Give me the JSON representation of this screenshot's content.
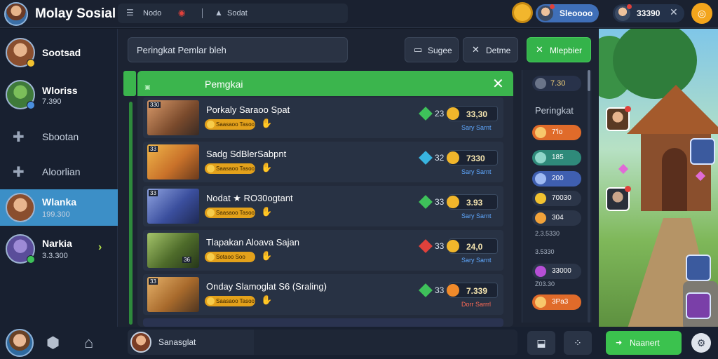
{
  "topbar": {
    "app_title": "Molay Sosial",
    "tools": [
      {
        "icon": "list-icon",
        "label": "Nodo"
      },
      {
        "icon": "eye-icon",
        "label": ""
      },
      {
        "icon": "warning-icon",
        "label": "Sodat"
      }
    ],
    "currency_blue": "Sleoooo",
    "currency_dark": "33390"
  },
  "sidebar": {
    "items": [
      {
        "name": "Sootsad",
        "sub": "",
        "kind": "avatar",
        "color": "#8a4e2e"
      },
      {
        "name": "Wloriss",
        "sub": "7.390",
        "kind": "avatar",
        "color": "#3f7a3a"
      },
      {
        "name": "Sbootan",
        "sub": "",
        "kind": "glyph"
      },
      {
        "name": "Aloorlian",
        "sub": "",
        "kind": "glyph"
      },
      {
        "name": "Wlanka",
        "sub": "199.300",
        "kind": "avatar",
        "active": true,
        "color": "#8a4e2e"
      },
      {
        "name": "Narkia",
        "sub": "3.3.300",
        "kind": "avatar",
        "color": "#5a4d9a"
      }
    ]
  },
  "main": {
    "search_placeholder": "Peringkat Pemlar bleh",
    "buttons": {
      "sugee": "Sugee",
      "detme": "Detme",
      "mlepbier": "Mlepbier"
    },
    "list_header": "Pemgkai",
    "rows": [
      {
        "num": "330",
        "title": "Porkaly Saraoo Spat",
        "tag": "Saasaoo Tasoo",
        "rank": "23",
        "gem_color": "#3ec15a",
        "score": "33,30",
        "link": "Sary Sarnt",
        "link_color": "#5fa8ff",
        "thumb": "#7a4a2c"
      },
      {
        "num": "33",
        "title": "Sadg SdBlerSabpnt",
        "tag": "Saasaoo Tasoo",
        "rank": "32",
        "gem_color": "#38b4e0",
        "score": "7330",
        "link": "Sary Sarnt",
        "link_color": "#5fa8ff",
        "thumb": "#c9722a"
      },
      {
        "num": "33",
        "title": "Nodat ★ RO30ogtant",
        "tag": "Saasaoo Tasoo",
        "rank": "33",
        "gem_color": "#3ec15a",
        "score": "3.93",
        "link": "Sary Sarnt",
        "link_color": "#5fa8ff",
        "thumb": "#3b4f9e"
      },
      {
        "num": "36",
        "title": "Tlapakan Aloava Sajan",
        "tag": "Sotaoo Soo",
        "rank": "33",
        "gem_color": "#e0413b",
        "score": "24,0",
        "link": "Sary Sarnt",
        "link_color": "#5fa8ff",
        "thumb": "#4e6b2a"
      },
      {
        "num": "33",
        "title": "Onday Slamoglat S6 (Sraling)",
        "tag": "Saasaoo Tasoo",
        "rank": "33",
        "gem_color": "#3ec15a",
        "score": "7.339",
        "link": "Dorr Sarrrl",
        "link_color": "#ff6a55",
        "thumb": "#a86a2c"
      }
    ]
  },
  "ranking": {
    "top_value": "7.30",
    "title": "Peringkat",
    "rows": [
      {
        "value": "7'lo",
        "bg": "#e06b2a",
        "icon": "#f7c76b"
      },
      {
        "value": "185",
        "bg": "#2f8a7a",
        "icon": "#8fd6c9"
      },
      {
        "value": "200",
        "bg": "#3f5fb0",
        "icon": "#9fbaf2"
      },
      {
        "value": "70030",
        "bg": "#2b3548",
        "icon": "#f2c230"
      },
      {
        "value": "304",
        "bg": "#2b3548",
        "icon": "#f2a33a"
      },
      {
        "value": "33000",
        "bg": "#2b3548",
        "icon": "#b64fd6"
      },
      {
        "value": "3Pa3",
        "bg": "#e06b2a",
        "icon": "#f7c76b"
      }
    ],
    "subs": [
      "Z03.30",
      "3.5330",
      "2.3.5330"
    ]
  },
  "bottom": {
    "chat_label": "Sanasglat",
    "next_label": "Naanert"
  },
  "colors": {
    "accent_green": "#3bb54d",
    "accent_blue": "#3c8fc7",
    "gold": "#f1b62b"
  }
}
